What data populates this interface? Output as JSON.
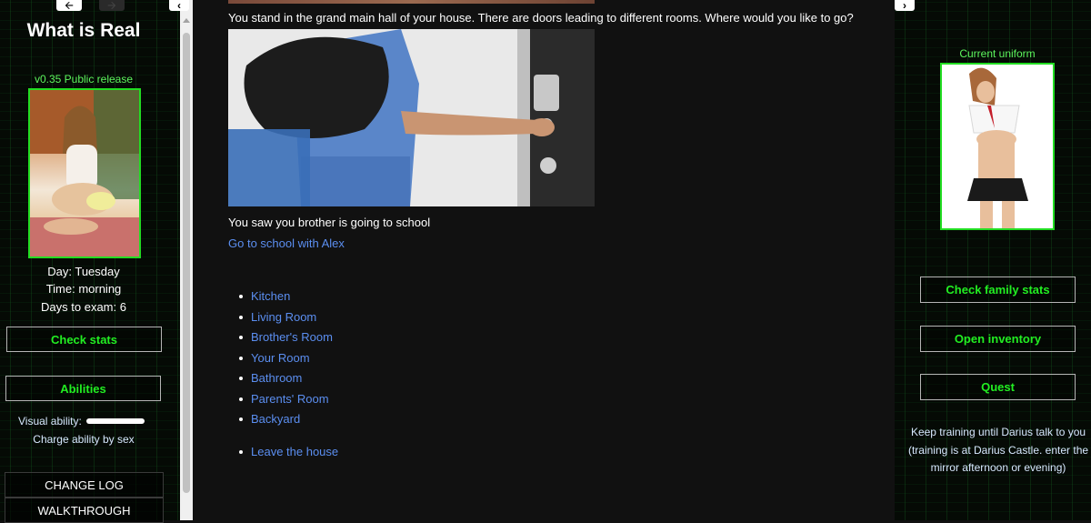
{
  "left": {
    "title": "What is Real",
    "version": "v0.35 Public release",
    "day": "Day: Tuesday",
    "time": "Time: morning",
    "exam": "Days to exam: 6",
    "check_stats": "Check stats",
    "abilities": "Abilities",
    "visual_ability_label": "Visual ability:",
    "visual_ability_level": 1.0,
    "charge_text": "Charge ability by sex",
    "change_log": "CHANGE LOG",
    "walkthrough": "WALKTHROUGH"
  },
  "main": {
    "narration": "You stand in the grand main hall of your house. There are doors leading to different rooms. Where would you like to go?",
    "event_text": "You saw you brother is going to school",
    "event_link": "Go to school with Alex",
    "rooms": [
      "Kitchen",
      "Living Room",
      "Brother's Room",
      "Your Room",
      "Bathroom",
      "Parents' Room",
      "Backyard"
    ],
    "leave": "Leave the house"
  },
  "right": {
    "uniform_label": "Current uniform",
    "family_stats": "Check family stats",
    "inventory": "Open inventory",
    "quest": "Quest",
    "quest_text": "Keep training until Darius talk to you (training is at Darius Castle. enter the mirror afternoon or evening)"
  },
  "icons": {
    "back": "arrow-left-icon",
    "forward": "arrow-right-icon",
    "collapse_left": "chevron-left-icon",
    "collapse_right": "chevron-right-icon"
  },
  "colors": {
    "accent_green": "#22ee22",
    "link_blue": "#5b8ef0",
    "background": "#111111"
  }
}
